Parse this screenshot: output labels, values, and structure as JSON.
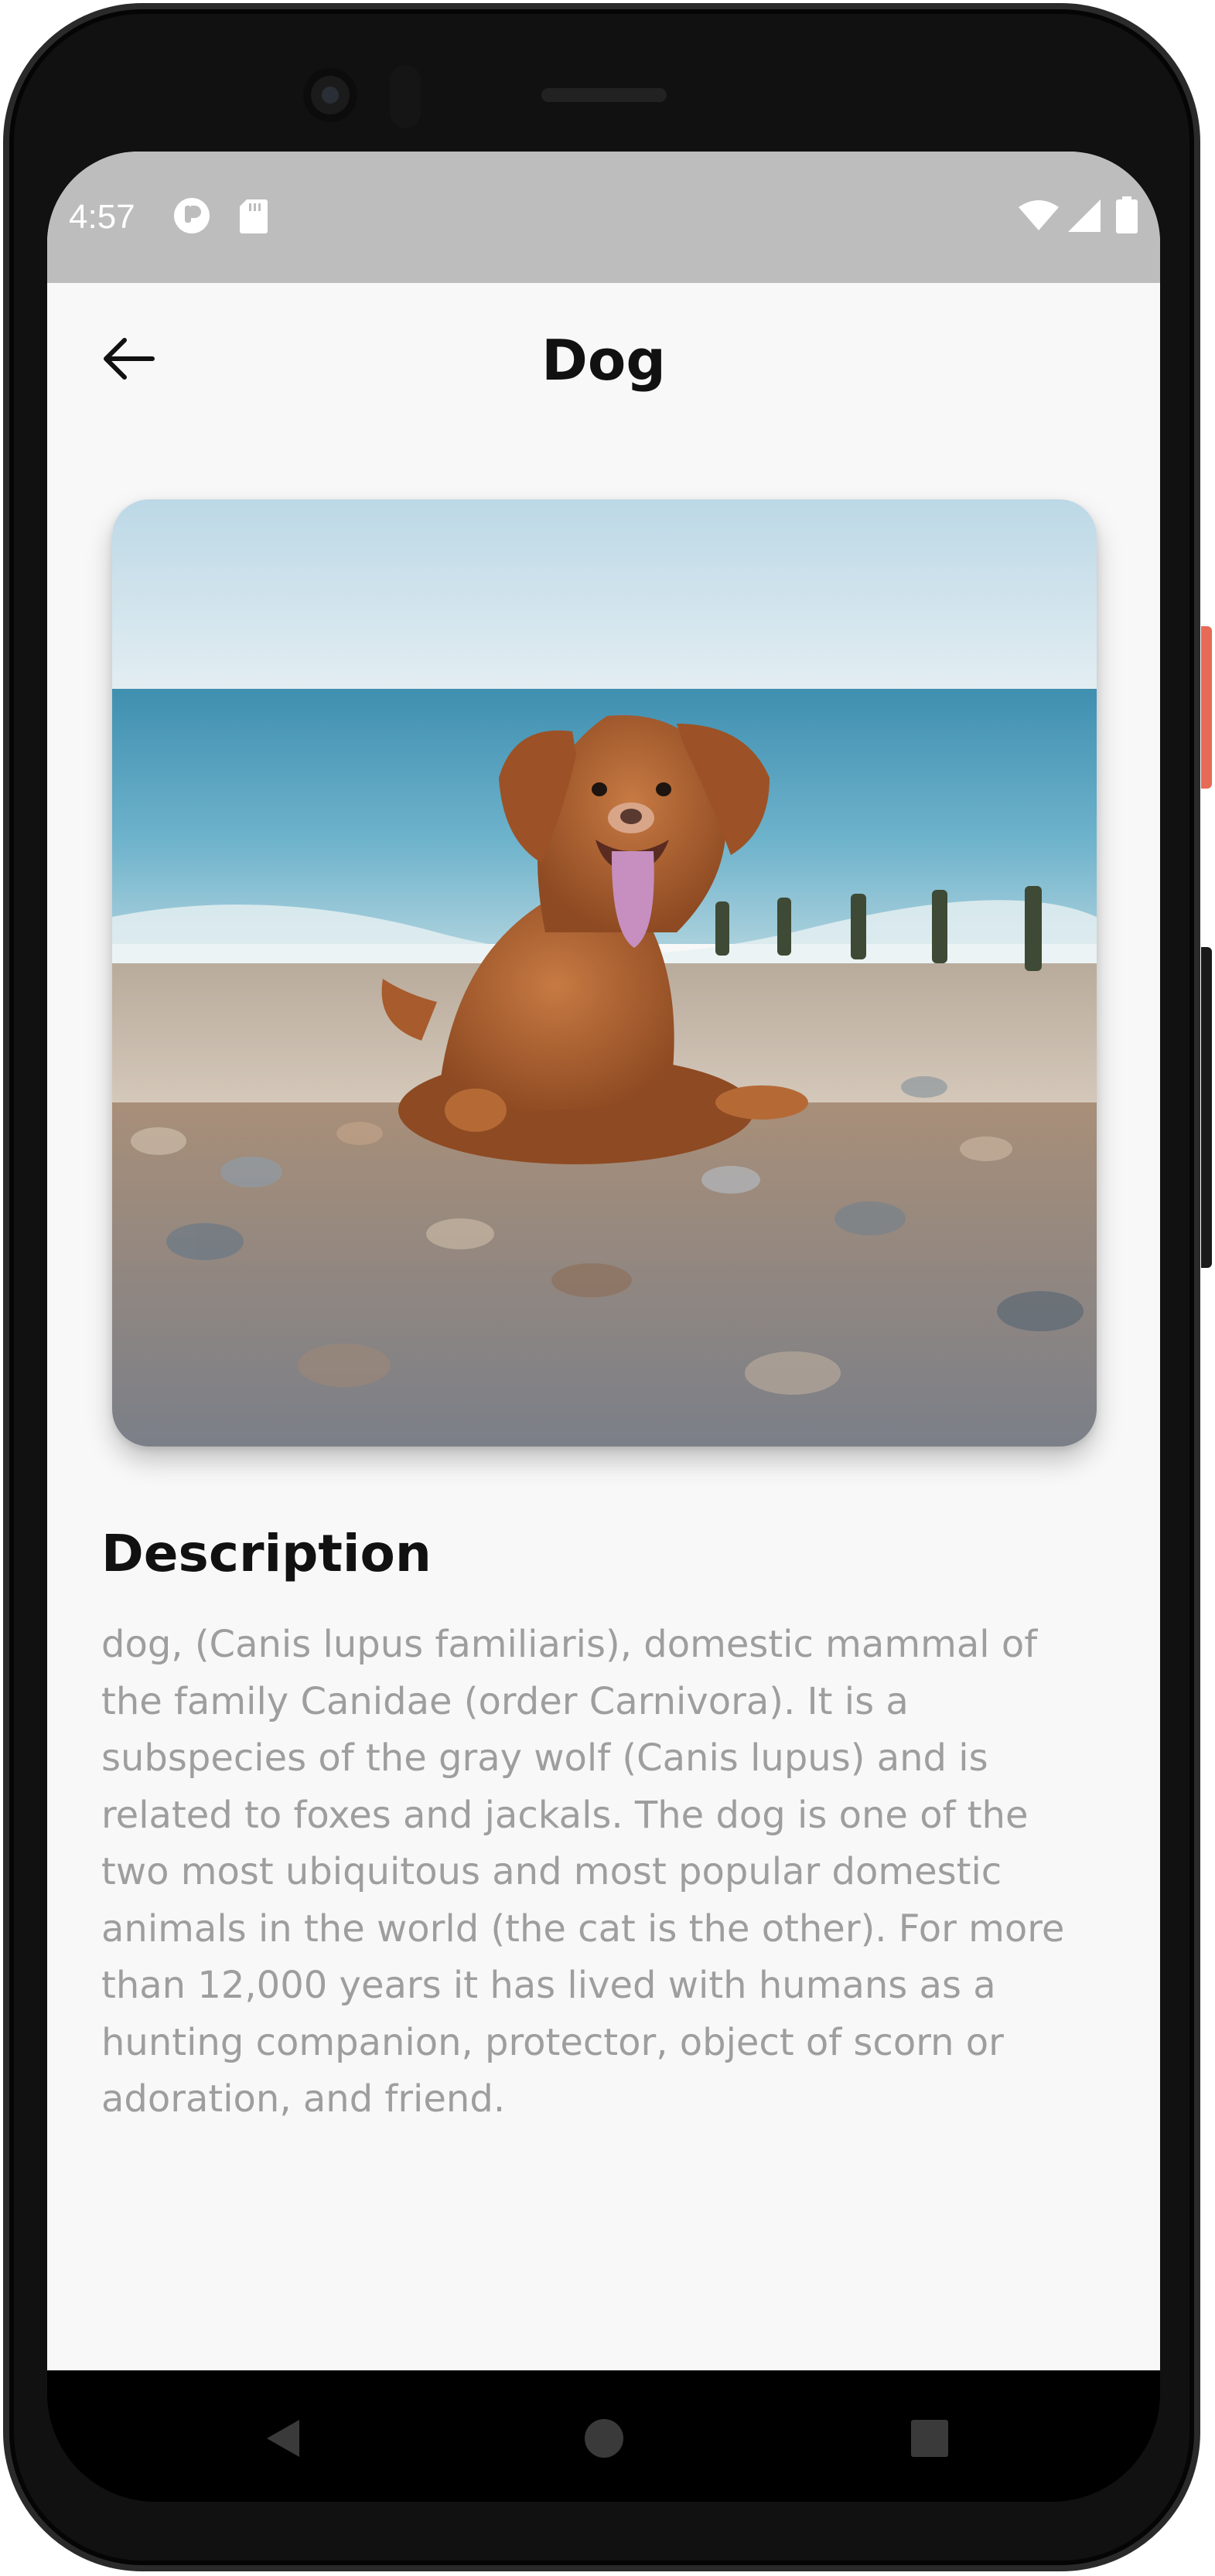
{
  "status_bar": {
    "time": "4:57",
    "left_icons": [
      "app-notification-icon",
      "sd-card-icon"
    ],
    "right_icons": [
      "wifi-icon",
      "cell-signal-icon",
      "battery-icon"
    ]
  },
  "app_bar": {
    "title": "Dog",
    "back_icon": "arrow-left-icon"
  },
  "image": {
    "subject": "dog-on-pebble-beach-photo"
  },
  "description": {
    "heading": "Description",
    "lines": [
      "dog, (Canis lupus familiaris), domestic mammal of",
      "the family Canidae (order Carnivora). It is a",
      "subspecies of the gray wolf (Canis lupus) and is",
      "related to foxes and jackals. The dog is one of the",
      "two most ubiquitous and most popular domestic",
      "animals in the world (the cat is the other). For more",
      "than 12,000 years it has lived with humans as a",
      "hunting companion, protector, object of scorn or",
      "adoration, and friend."
    ]
  },
  "nav_bar": {
    "buttons": [
      "back-triangle-icon",
      "home-circle-icon",
      "recents-square-icon"
    ]
  },
  "colors": {
    "status_bar": "#bdbdbd",
    "screen_bg": "#f8f8f8",
    "title_text": "#111111",
    "body_text": "#9e9e9e",
    "nav_bar": "#000000"
  }
}
